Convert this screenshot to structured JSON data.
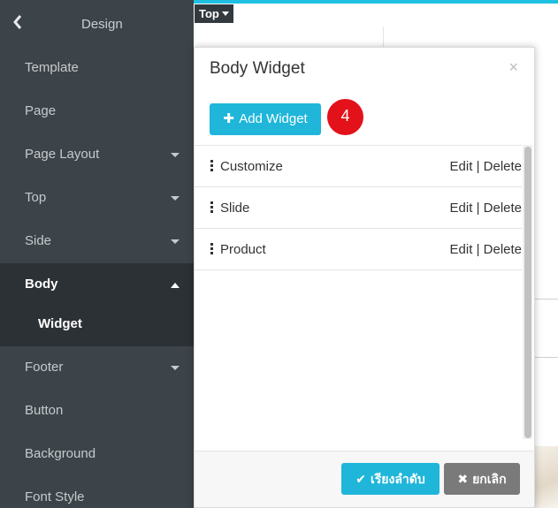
{
  "sidebar": {
    "title": "Design",
    "items": [
      {
        "label": "Template",
        "caret": false
      },
      {
        "label": "Page",
        "caret": false
      },
      {
        "label": "Page Layout",
        "caret": true
      },
      {
        "label": "Top",
        "caret": true
      },
      {
        "label": "Side",
        "caret": true
      },
      {
        "label": "Body",
        "caret": "up"
      },
      {
        "label": "Footer",
        "caret": true
      },
      {
        "label": "Button",
        "caret": false
      },
      {
        "label": "Background",
        "caret": false
      },
      {
        "label": "Font Style",
        "caret": false
      }
    ],
    "sub_item": "Widget"
  },
  "canvas": {
    "top_badge": "Top"
  },
  "modal": {
    "title": "Body Widget",
    "close": "×",
    "add_button": "Add Widget",
    "step_badge": "4",
    "widgets": [
      {
        "name": "Customize",
        "edit": "Edit",
        "sep": "|",
        "delete": "Delete"
      },
      {
        "name": "Slide",
        "edit": "Edit",
        "sep": "|",
        "delete": "Delete"
      },
      {
        "name": "Product",
        "edit": "Edit",
        "sep": "|",
        "delete": "Delete"
      }
    ],
    "sort_button": "เรียงลำดับ",
    "cancel_button": "ยกเลิก"
  },
  "colors": {
    "sidebar_bg": "#3d4449",
    "accent": "#1fb6da",
    "badge": "#e3121a"
  }
}
